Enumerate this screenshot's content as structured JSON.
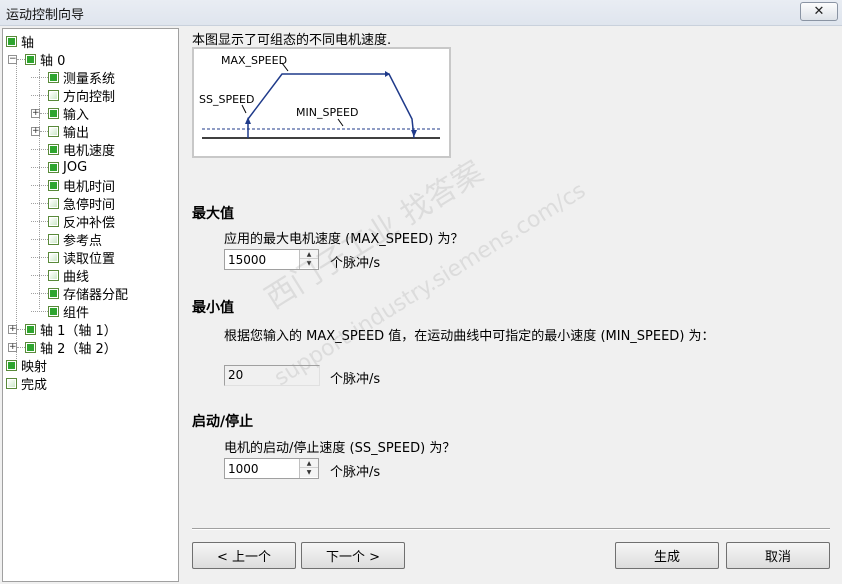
{
  "window": {
    "title": "运动控制向导",
    "close_glyph": "✕"
  },
  "tree": {
    "items": [
      {
        "label": "轴",
        "checked": true,
        "expander": ""
      },
      {
        "label": "轴 0",
        "checked": true,
        "expander": "−"
      },
      {
        "label": "测量系统",
        "checked": true,
        "expander": ""
      },
      {
        "label": "方向控制",
        "checked": false,
        "expander": ""
      },
      {
        "label": "输入",
        "checked": true,
        "expander": "+"
      },
      {
        "label": "输出",
        "checked": false,
        "expander": "+"
      },
      {
        "label": "电机速度",
        "checked": true,
        "expander": ""
      },
      {
        "label": "JOG",
        "checked": true,
        "expander": ""
      },
      {
        "label": "电机时间",
        "checked": true,
        "expander": ""
      },
      {
        "label": "急停时间",
        "checked": false,
        "expander": ""
      },
      {
        "label": "反冲补偿",
        "checked": false,
        "expander": ""
      },
      {
        "label": "参考点",
        "checked": false,
        "expander": ""
      },
      {
        "label": "读取位置",
        "checked": false,
        "expander": ""
      },
      {
        "label": "曲线",
        "checked": false,
        "expander": ""
      },
      {
        "label": "存储器分配",
        "checked": true,
        "expander": ""
      },
      {
        "label": "组件",
        "checked": true,
        "expander": ""
      },
      {
        "label": "轴 1（轴 1）",
        "checked": true,
        "expander": "+"
      },
      {
        "label": "轴 2（轴 2）",
        "checked": true,
        "expander": "+"
      },
      {
        "label": "映射",
        "checked": true,
        "expander": ""
      },
      {
        "label": "完成",
        "checked": false,
        "expander": ""
      }
    ]
  },
  "main": {
    "intro": "本图显示了可组态的不同电机速度.",
    "diagram": {
      "max_label": "MAX_SPEED",
      "ss_label": "SS_SPEED",
      "min_label": "MIN_SPEED"
    },
    "max_section": {
      "heading": "最大值",
      "prompt": "应用的最大电机速度 (MAX_SPEED) 为？",
      "value": "15000",
      "unit": "个脉冲/s"
    },
    "min_section": {
      "heading": "最小值",
      "prompt": "根据您输入的 MAX_SPEED 值，在运动曲线中可指定的最小速度 (MIN_SPEED) 为：",
      "value": "20",
      "unit": "个脉冲/s"
    },
    "start_section": {
      "heading": "启动/停止",
      "prompt": "电机的启动/停止速度 (SS_SPEED) 为？",
      "value": "1000",
      "unit": "个脉冲/s"
    }
  },
  "buttons": {
    "prev": "< 上一个",
    "next": "下一个 >",
    "generate": "生成",
    "cancel": "取消"
  },
  "watermark": {
    "line1": "西门子工业  找答案",
    "line2": "support.industry.siemens.com/cs"
  },
  "colors": {
    "check_fill": "#2ea52e",
    "diagram_line": "#1f3a8a"
  }
}
